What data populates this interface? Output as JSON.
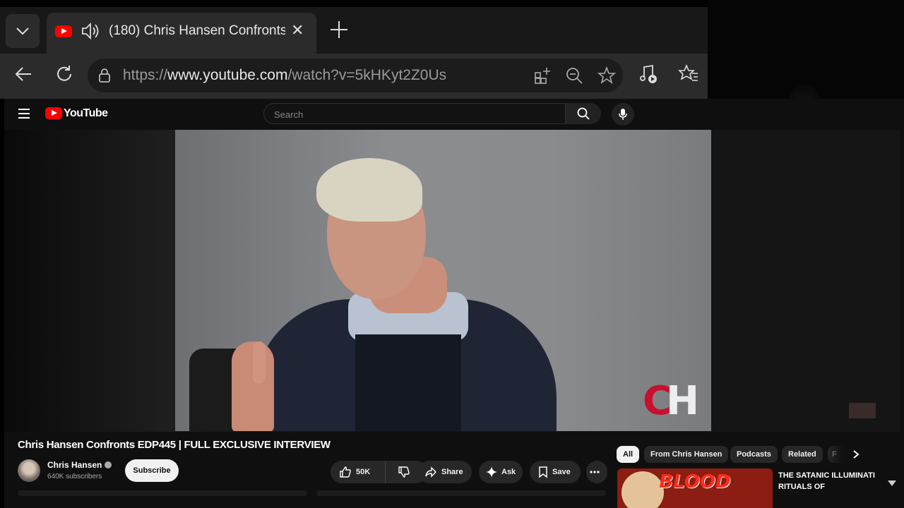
{
  "browser": {
    "tab": {
      "title": "(180) Chris Hansen Confronts",
      "favicon": "youtube-icon"
    },
    "url_prefix": "https://",
    "url_domain": "www.youtube.com",
    "url_path": "/watch?v=5kHKyt2Z0Us"
  },
  "youtube": {
    "logo_text": "YouTube",
    "search_placeholder": "Search",
    "video": {
      "title": "Chris Hansen Confronts EDP445 | FULL EXCLUSIVE INTERVIEW",
      "overlay_logo_c": "C",
      "overlay_logo_h": "H"
    },
    "channel": {
      "name": "Chris Hansen",
      "subscribers": "640K subscribers",
      "subscribe_label": "Subscribe"
    },
    "actions": {
      "likes": "50K",
      "share": "Share",
      "ask": "Ask",
      "save": "Save"
    },
    "chips": [
      "All",
      "From Chris Hansen",
      "Podcasts",
      "Related",
      "F"
    ],
    "recommendation": {
      "thumb_text": "BLOOD",
      "title": "THE SATANIC ILLUMINATI RITUALS OF"
    }
  },
  "colors": {
    "youtube_red": "#ff0000",
    "background": "#0f0f0f",
    "chip_bg": "#272727",
    "accent_red": "#c8102e"
  }
}
